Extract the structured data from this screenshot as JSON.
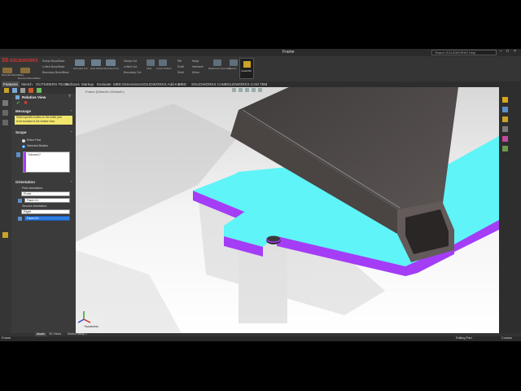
{
  "window": {
    "title": "Frame",
    "search_placeholder": "Search SOLIDWORKS Help"
  },
  "brand": {
    "logo_text": "SOLIDWORKS"
  },
  "ribbon": {
    "groups": [
      {
        "label": "Extruded Boss/Base"
      },
      {
        "label": "Revolved Boss/Base"
      },
      {
        "label": "Swept Boss/Base"
      },
      {
        "label": "Lofted Boss/Base"
      },
      {
        "label": "Boundary Boss/Base"
      },
      {
        "label": "Extruded Cut"
      },
      {
        "label": "Hole Wizard"
      },
      {
        "label": "Revolved Cut"
      },
      {
        "label": "Swept Cut"
      },
      {
        "label": "Lofted Cut"
      },
      {
        "label": "Boundary Cut"
      },
      {
        "label": "Fillet"
      },
      {
        "label": "Linear Pattern"
      },
      {
        "label": "Rib"
      },
      {
        "label": "Wrap"
      },
      {
        "label": "Draft"
      },
      {
        "label": "Intersect"
      },
      {
        "label": "Shell"
      },
      {
        "label": "Mirror"
      },
      {
        "label": "Reference Geometry"
      },
      {
        "label": "Curves"
      },
      {
        "label": "Instant3D"
      }
    ]
  },
  "tabs": [
    "Features",
    "Sketch",
    "OUTSIDERS TEAM",
    "Surfaces",
    "Markup",
    "Evaluate",
    "MBD Dimensions",
    "SOLIDWORKS Add-Ins",
    "MBD",
    "SOLIDWORKS CAM",
    "SOLIDWORKS CAM TBM"
  ],
  "panel": {
    "title": "Relative View",
    "message_header": "Message",
    "message_text_1": "Select specific bodies on the entire part",
    "message_text_2": "to be included in the relative view.",
    "scope_header": "Scope",
    "scope_option_1": "Entire Part",
    "scope_option_2": "Selected Bodies",
    "selected_body": "Tubular17",
    "orientation_header": "Orientation",
    "first_orientation_label": "First orientation:",
    "first_orientation_value": "Front",
    "first_face_value": "Face<1>",
    "second_orientation_label": "Second orientation:",
    "second_orientation_value": "Right",
    "second_face_value": "Face<2>"
  },
  "viewport": {
    "breadcrumb": "Frame (Default<<Default>)",
    "view_label": "*Isometric"
  },
  "bottom_tabs": [
    "Model",
    "3D Views",
    "Motion Study 1"
  ],
  "status": {
    "left": "Frame",
    "editing": "Editing Part",
    "units": "Custom"
  },
  "colors": {
    "plate_top": "#5ff4f7",
    "plate_side": "#a43df6",
    "tube": "#4a4443"
  }
}
